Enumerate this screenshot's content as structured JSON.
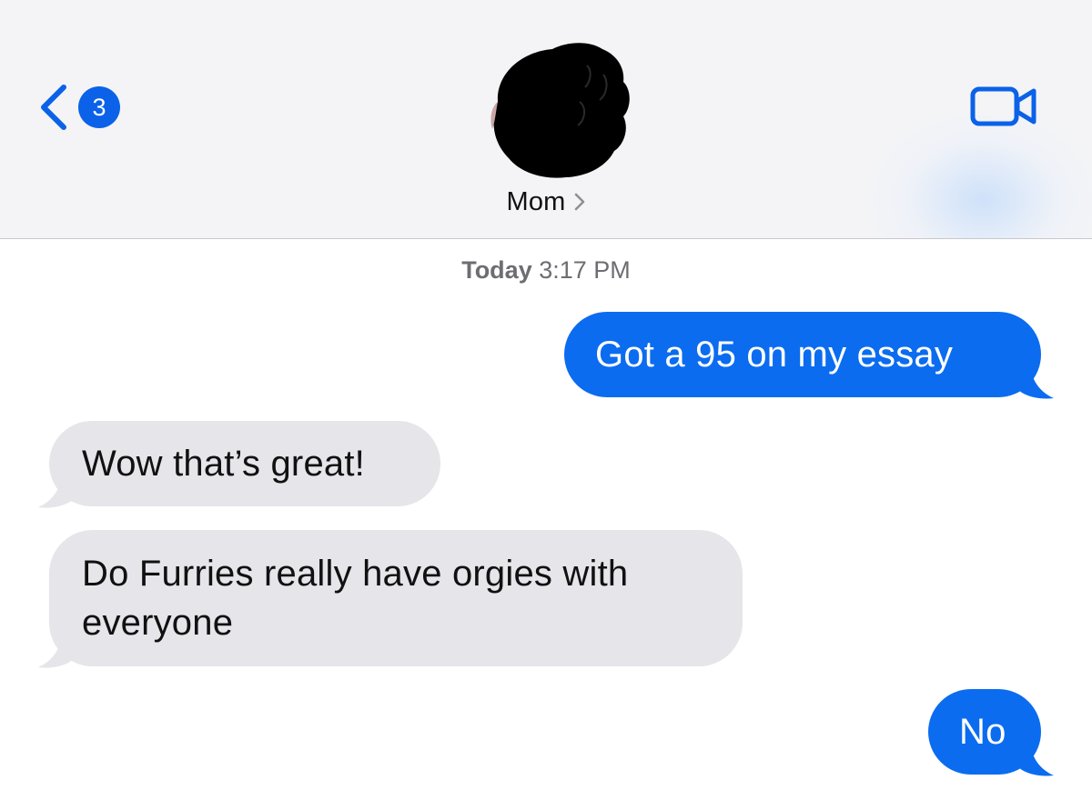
{
  "header": {
    "back_badge_count": "3",
    "contact_name": "Mom",
    "icons": {
      "back": "chevron-left-icon",
      "details": "chevron-right-icon",
      "video": "video-camera-icon"
    }
  },
  "conversation": {
    "timestamp_day": "Today",
    "timestamp_time": "3:17 PM",
    "messages": [
      {
        "direction": "outgoing",
        "text": "Got a 95 on my essay"
      },
      {
        "direction": "incoming",
        "text": "Wow that’s great!"
      },
      {
        "direction": "incoming",
        "text": "Do Furries really have orgies with everyone"
      },
      {
        "direction": "outgoing",
        "text": "No"
      }
    ]
  },
  "colors": {
    "accent": "#0b62e8",
    "outgoing_bubble": "#0b6cf0",
    "incoming_bubble": "#e5e5ea",
    "header_background": "#f4f4f6",
    "timestamp_text": "#6d6d72"
  }
}
